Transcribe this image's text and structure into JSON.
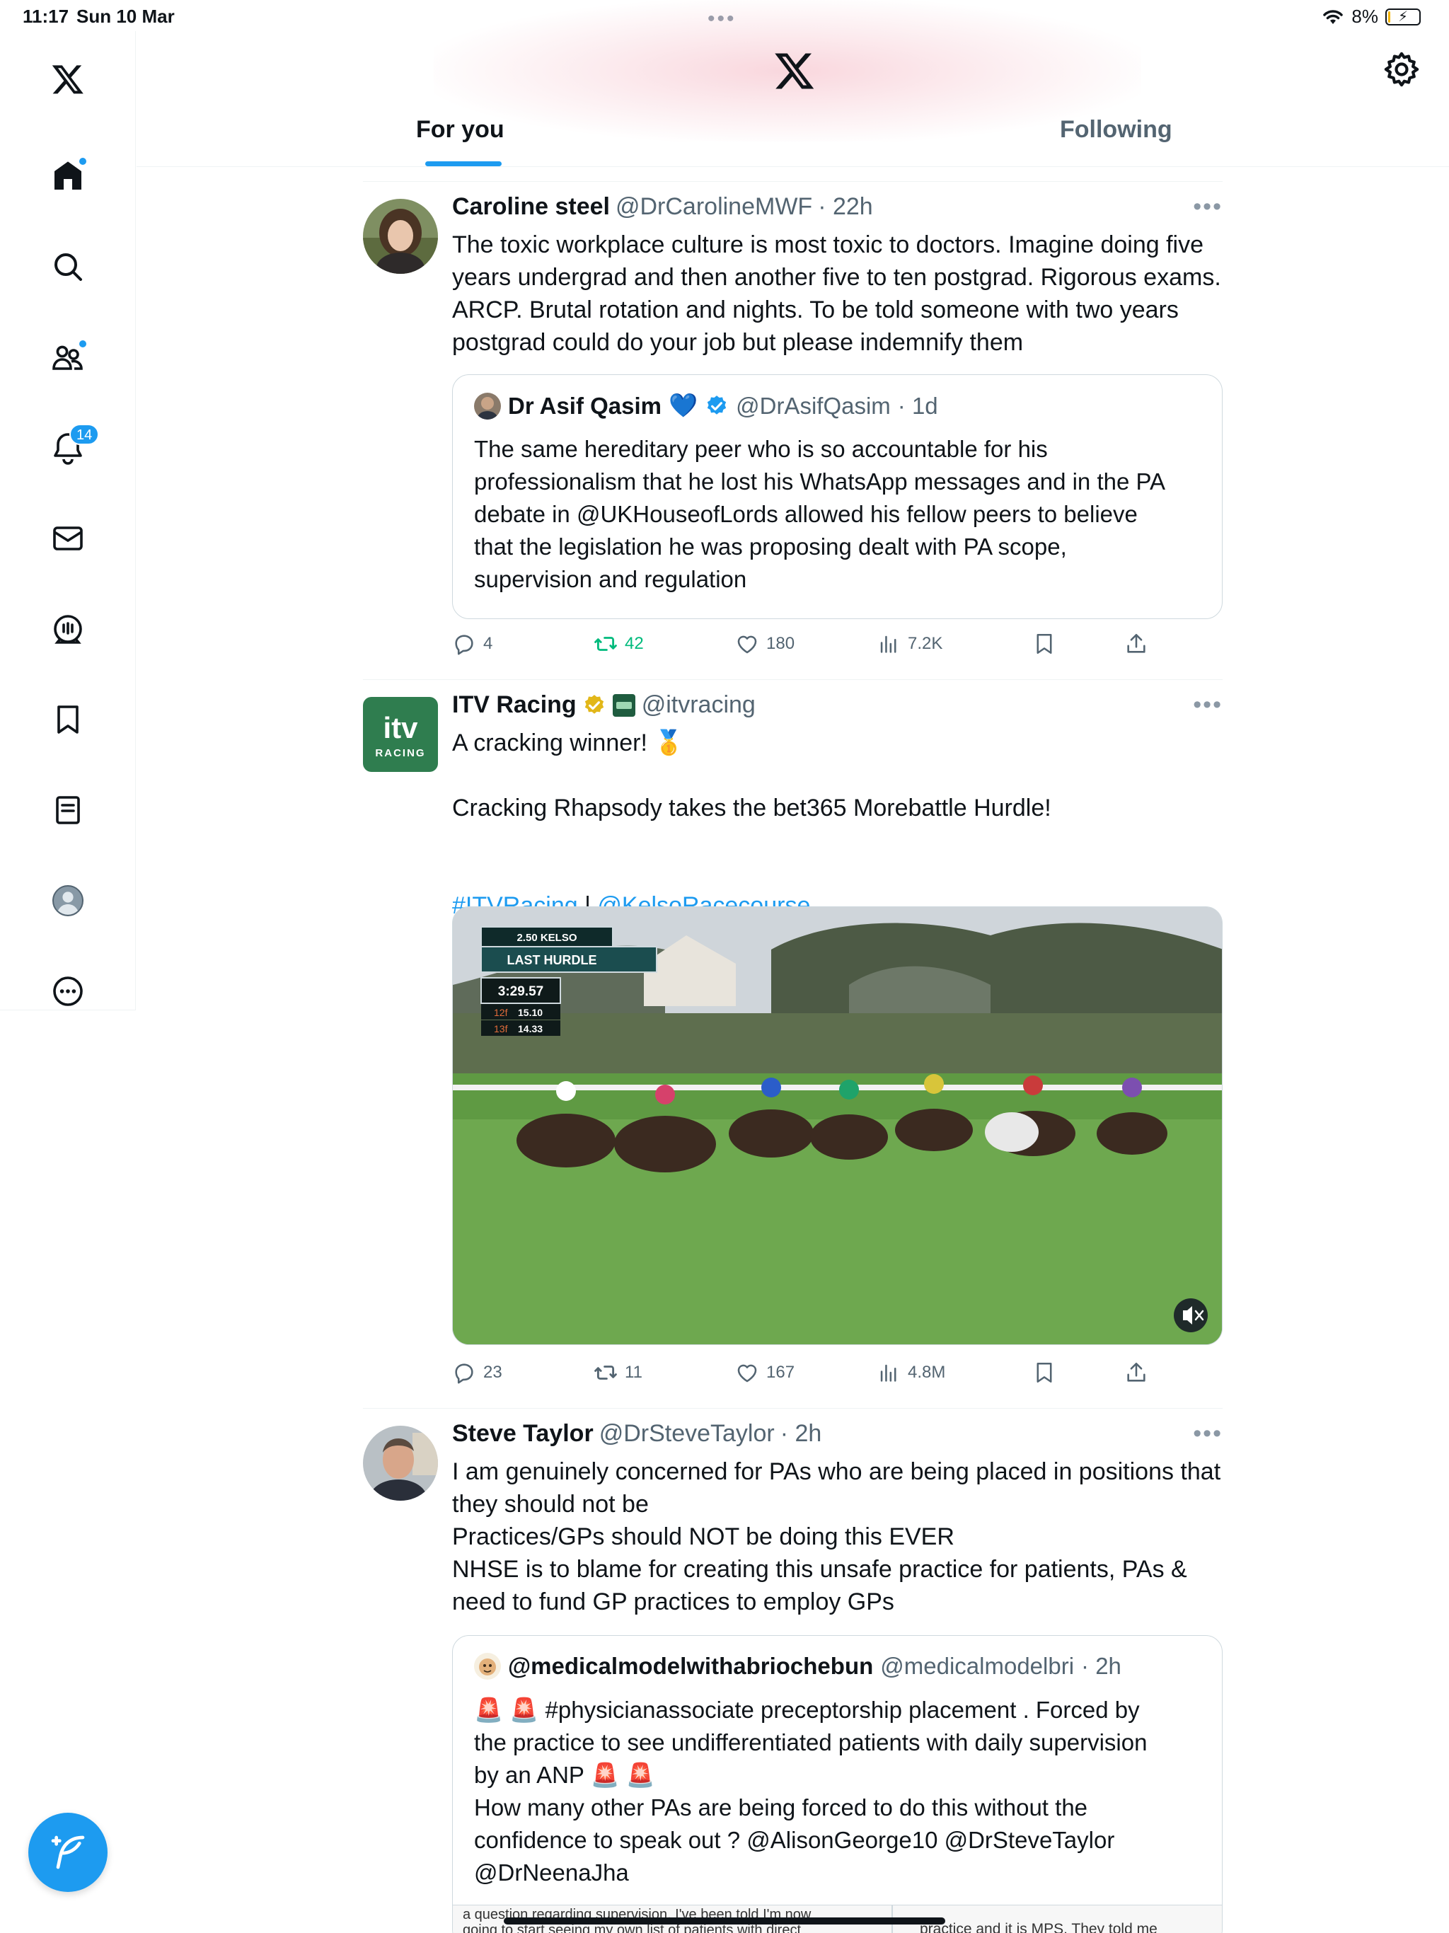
{
  "status_bar": {
    "time": "11:17",
    "date": "Sun 10 Mar",
    "battery": "8%",
    "battery_level": 0.08
  },
  "header": {
    "tabs": [
      {
        "label": "For you",
        "selected": true
      },
      {
        "label": "Following",
        "selected": false
      }
    ]
  },
  "sidebar": {
    "items": [
      "home-icon",
      "search-icon",
      "communities-icon",
      "notifications-icon",
      "messages-icon",
      "spaces-icon",
      "bookmarks-icon",
      "lists-icon",
      "profile-icon",
      "more-icon"
    ],
    "notifications_count": "14"
  },
  "colors": {
    "accent": "#1d9bf0",
    "text": "#0f1419",
    "muted": "#536471",
    "retweet_active": "#00ba7c",
    "itv_green": "#2f7d4f"
  },
  "tweets": [
    {
      "name": "Caroline steel",
      "handle": "@DrCarolineMWF",
      "time": "· 22h",
      "text": "The toxic workplace culture is most toxic to doctors. Imagine doing five\nyears undergrad and then another five to ten postgrad. Rigorous exams.\nARCP. Brutal rotation and nights. To be told someone with two years\npostgrad could do your job but please indemnify them",
      "quote": {
        "name": "Dr Asif Qasim",
        "emoji": "💙",
        "handle": "@DrAsifQasim",
        "time": "· 1d",
        "text": "The same hereditary peer who is so accountable for his\nprofessionalism that he lost his WhatsApp messages and in the PA\ndebate in @UKHouseofLords allowed his fellow peers to believe\nthat the legislation he was proposing dealt with PA scope,\nsupervision and regulation"
      },
      "stats": {
        "replies": "4",
        "retweets": "42",
        "likes": "180",
        "views": "7.2K"
      }
    },
    {
      "name": "ITV Racing",
      "handle": "@itvracing",
      "text_line1": "A cracking winner! 🥇",
      "text_line2": "Cracking Rhapsody takes the bet365 Morebattle Hurdle!",
      "hashtag": "#ITVRacing",
      "separator": " | ",
      "mention": "@KelsoRacecourse",
      "logo_text": "itv",
      "logo_sub": "RACING",
      "video": {
        "race": "2.50 KELSO",
        "stage": "LAST HURDLE",
        "timer": "3:29.57",
        "split1_label": "12f",
        "split1": "15.10",
        "split2_label": "13f",
        "split2": "14.33"
      },
      "stats": {
        "replies": "23",
        "retweets": "11",
        "likes": "167",
        "views": "4.8M"
      }
    },
    {
      "name": "Steve Taylor",
      "handle": "@DrSteveTaylor",
      "time": "· 2h",
      "text": "I am genuinely concerned for PAs who are being placed in positions that\nthey should not be\nPractices/GPs should NOT be doing this EVER\nNHSE is to blame for creating this unsafe practice for patients, PAs &\nneed to fund GP practices to employ GPs",
      "quote": {
        "name": "@medicalmodelwithabriochebun",
        "handle": "@medicalmodelbri",
        "time": "· 2h",
        "text": "🚨 🚨 #physicianassociate preceptorship placement . Forced by\nthe practice to see undifferentiated patients with daily supervision\nby an ANP 🚨 🚨\nHow many other PAs are being forced to do this without the\nconfidence to speak out ? @AlisonGeorge10 @DrSteveTaylor\n@DrNeenaJha",
        "image_left_text": "a question regarding supervision. I've been told I'm now\ngoing to start seeing my own list of patients with direct",
        "image_right_text": "practice and it is MPS.  They told me"
      }
    }
  ]
}
